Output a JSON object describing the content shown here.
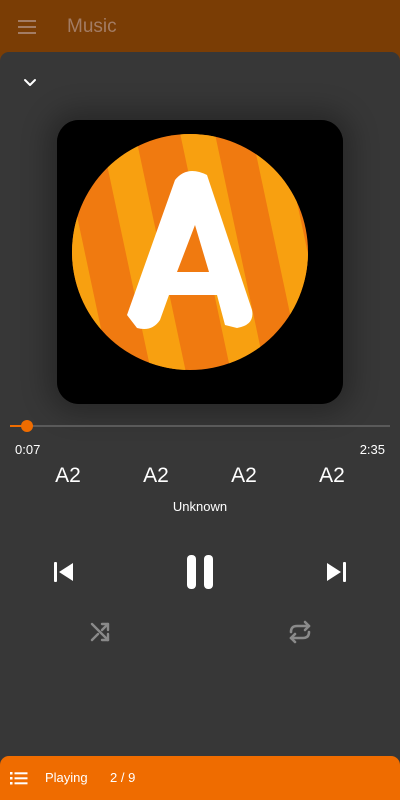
{
  "app": {
    "title": "Music"
  },
  "player": {
    "elapsed": "0:07",
    "total": "2:35",
    "progress_fraction": 0.045,
    "meta": [
      "A2",
      "A2",
      "A2",
      "A2"
    ],
    "artist": "Unknown"
  },
  "bottom_bar": {
    "status_label": "Playing",
    "queue_position": "2 / 9"
  },
  "icons": {
    "menu": "menu-icon",
    "collapse": "chevron-down-icon",
    "previous": "skip-previous-icon",
    "pause": "pause-icon",
    "next": "skip-next-icon",
    "shuffle": "shuffle-icon",
    "repeat": "repeat-icon",
    "queue": "queue-list-icon"
  },
  "colors": {
    "accent": "#ef6c00",
    "toolbar": "#7a3d05",
    "sheet": "#373737"
  }
}
